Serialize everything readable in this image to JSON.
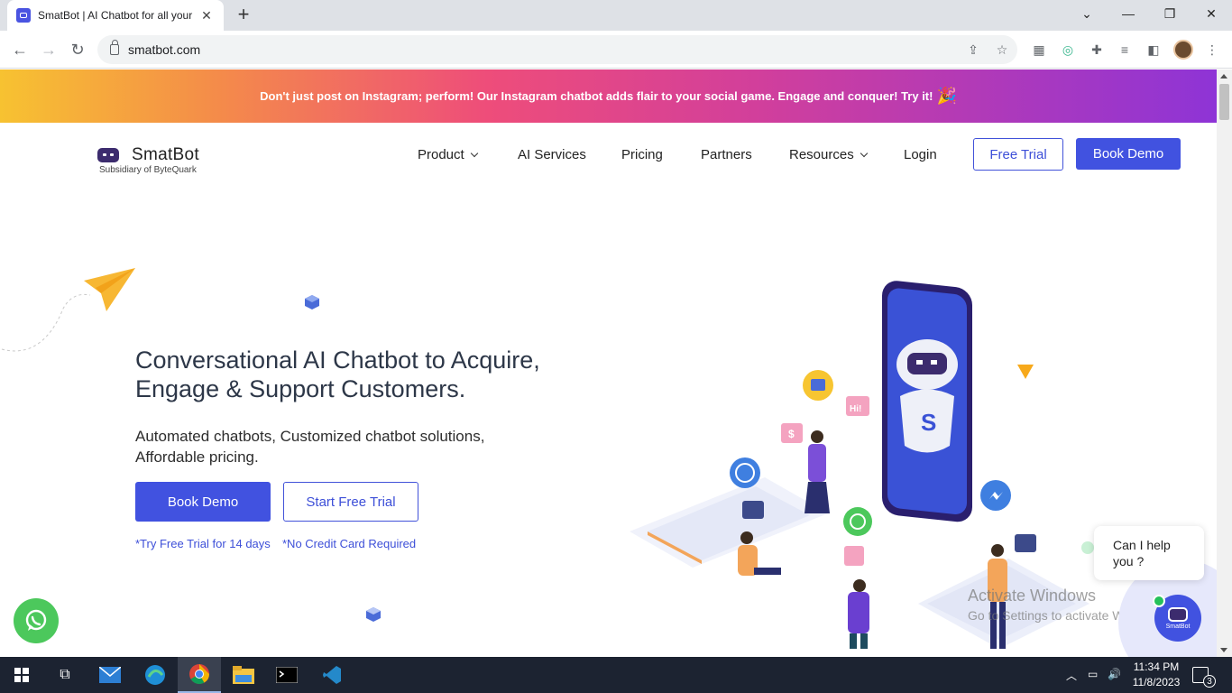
{
  "browser": {
    "tab_title": "SmatBot | AI Chatbot for all your",
    "tab_close": "✕",
    "new_tab": "+",
    "url": "smatbot.com"
  },
  "site": {
    "banner_text": "Don't just post on Instagram; perform! Our Instagram chatbot adds flair to your social game. Engage and conquer! Try it!",
    "banner_emoji": "🎉",
    "logo_name": "SmatBot",
    "logo_sub": "Subsidiary of ByteQuark",
    "nav": {
      "product": "Product",
      "ai_services": "AI Services",
      "pricing": "Pricing",
      "partners": "Partners",
      "resources": "Resources",
      "login": "Login",
      "free_trial": "Free Trial",
      "book_demo": "Book Demo"
    },
    "hero": {
      "title": "Conversational AI Chatbot to Acquire, Engage & Support Customers.",
      "subtitle": "Automated chatbots, Customized chatbot solutions, Affordable pricing.",
      "book_demo": "Book Demo",
      "start_trial": "Start Free Trial",
      "note_trial": "*Try Free Trial for 14 days",
      "note_card": "*No Credit Card Required"
    },
    "illustration": {
      "hi_text": "Hi!",
      "dollar_text": "$",
      "bot_letter": "S"
    },
    "chat_widget": {
      "line1": "Can I help",
      "line2": "you ?",
      "bot_label": "SmatBot"
    },
    "watermark": {
      "line1": "Activate Windows",
      "line2": "Go to Settings to activate Windows."
    },
    "colors": {
      "primary": "#4152e0",
      "heading": "#2d3748",
      "whatsapp": "#4cc85c"
    }
  },
  "taskbar": {
    "time": "11:34 PM",
    "date": "11/8/2023",
    "notifications": "3"
  }
}
